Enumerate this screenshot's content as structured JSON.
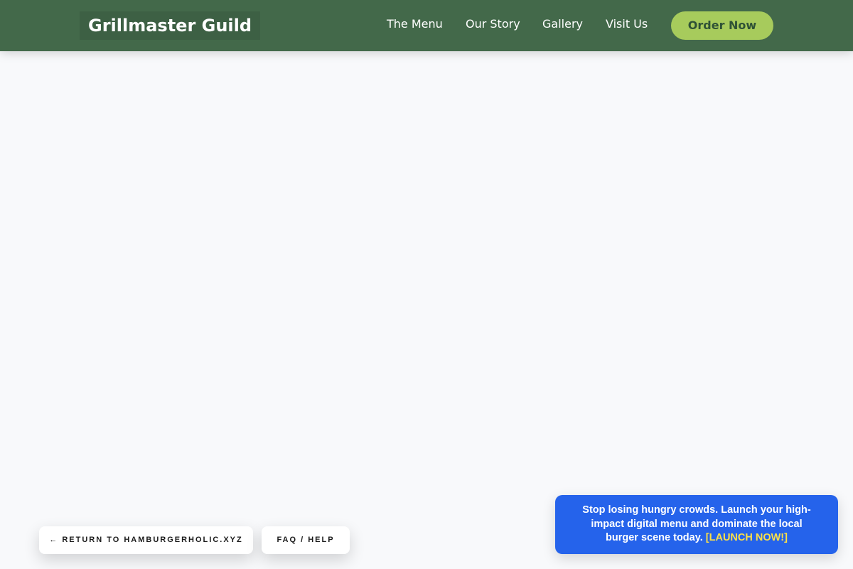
{
  "header": {
    "brand": "Grillmaster Guild",
    "nav": [
      {
        "label": "The Menu"
      },
      {
        "label": "Our Story"
      },
      {
        "label": "Gallery"
      },
      {
        "label": "Visit Us"
      }
    ],
    "cta_label": "Order Now"
  },
  "footer_buttons": {
    "return_label": "← RETURN TO HAMBURGERHOLIC.XYZ",
    "faq_label": "FAQ / HELP"
  },
  "promo": {
    "message": "Stop losing hungry crowds. Launch your high-impact digital menu and dominate the local burger scene today.",
    "cta": "[LAUNCH NOW!]"
  },
  "colors": {
    "header_bg": "#43694a",
    "brand_bg": "#3d6044",
    "cta_bg": "#a7cb5c",
    "page_bg": "#f8f9fb",
    "promo_bg": "#2563eb",
    "promo_cta": "#fde047"
  }
}
